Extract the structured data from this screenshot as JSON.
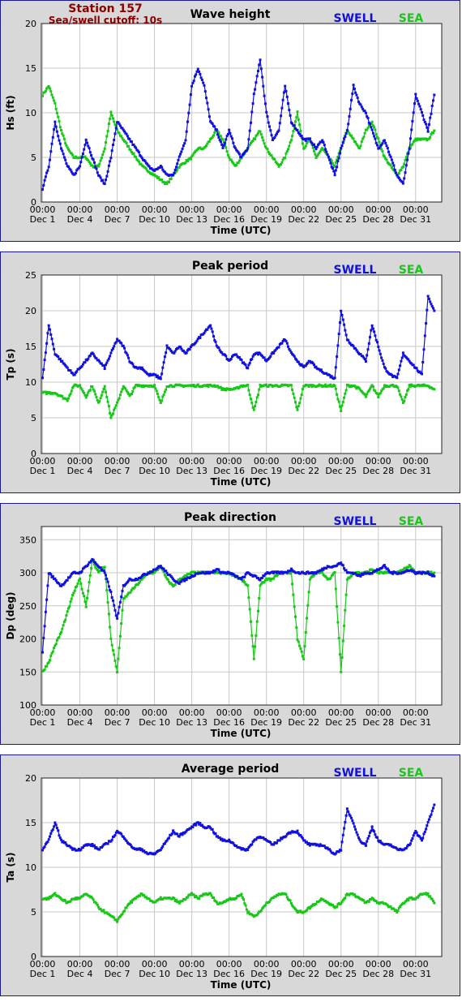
{
  "station": {
    "name": "Station 157",
    "cutoff": "Sea/swell cutoff: 10s"
  },
  "colors": {
    "swell": "#1010e0",
    "sea": "#18c818",
    "station_text": "#8b0000",
    "frame": "#1a1a99"
  },
  "legend": {
    "swell": "SWELL",
    "sea": "SEA"
  },
  "xaxis": {
    "title": "Time (UTC)",
    "time_labels": [
      "00:00",
      "00:00",
      "00:00",
      "00:00",
      "00:00",
      "00:00",
      "00:00",
      "00:00",
      "00:00",
      "00:00",
      "00:00"
    ],
    "date_labels": [
      "Dec 1",
      "Dec 4",
      "Dec 7",
      "Dec 10",
      "Dec 13",
      "Dec 16",
      "Dec 19",
      "Dec 22",
      "Dec 25",
      "Dec 28",
      "Dec 31"
    ],
    "tick_days": [
      1,
      4,
      7,
      10,
      13,
      16,
      19,
      22,
      25,
      28,
      31
    ],
    "range_days": [
      0.9,
      33.1
    ]
  },
  "chart_data": [
    {
      "type": "scatter",
      "title": "Wave height",
      "ylabel": "Hs (ft)",
      "ylim": [
        0,
        20
      ],
      "yticks": [
        0,
        5,
        10,
        15,
        20
      ],
      "grid": true,
      "legend_position": "top-right",
      "series": [
        {
          "name": "SWELL",
          "x": [
            1,
            1.5,
            2,
            2.5,
            3,
            3.5,
            4,
            4.5,
            5,
            5.5,
            6,
            6.5,
            7,
            7.5,
            8,
            8.5,
            9,
            9.5,
            10,
            10.5,
            11,
            11.5,
            12,
            12.5,
            13,
            13.5,
            14,
            14.5,
            15,
            15.5,
            16,
            16.5,
            17,
            17.5,
            18,
            18.5,
            19,
            19.5,
            20,
            20.5,
            21,
            21.5,
            22,
            22.5,
            23,
            23.5,
            24,
            24.5,
            25,
            25.5,
            26,
            26.5,
            27,
            27.5,
            28,
            28.5,
            29,
            29.5,
            30,
            30.5,
            31,
            31.5,
            32,
            32.5
          ],
          "y": [
            1.5,
            4,
            9,
            6,
            4,
            3,
            4,
            7,
            5,
            3,
            2,
            5,
            9,
            8,
            7,
            6,
            5,
            4,
            3.5,
            4,
            3,
            3,
            5,
            7,
            13,
            15,
            13,
            9,
            8,
            6,
            8,
            6,
            5,
            6,
            12,
            16,
            10,
            7,
            8,
            13,
            9,
            8,
            7,
            7,
            6,
            7,
            5,
            3,
            6,
            8,
            13,
            11,
            10,
            8,
            6,
            7,
            5,
            3,
            2,
            6,
            12,
            10,
            8,
            12
          ]
        },
        {
          "name": "SEA",
          "x": [
            1,
            1.5,
            2,
            2.5,
            3,
            3.5,
            4,
            4.5,
            5,
            5.5,
            6,
            6.5,
            7,
            7.5,
            8,
            8.5,
            9,
            9.5,
            10,
            10.5,
            11,
            11.5,
            12,
            12.5,
            13,
            13.5,
            14,
            14.5,
            15,
            15.5,
            16,
            16.5,
            17,
            17.5,
            18,
            18.5,
            19,
            19.5,
            20,
            20.5,
            21,
            21.5,
            22,
            22.5,
            23,
            23.5,
            24,
            24.5,
            25,
            25.5,
            26,
            26.5,
            27,
            27.5,
            28,
            28.5,
            29,
            29.5,
            30,
            30.5,
            31,
            31.5,
            32,
            32.5
          ],
          "y": [
            12,
            13,
            11,
            8,
            6,
            5,
            5,
            5,
            4,
            4,
            6,
            10,
            8,
            7,
            6,
            5,
            4,
            3.5,
            3,
            2.5,
            2,
            3,
            4,
            4.5,
            5,
            6,
            6,
            7,
            8,
            7,
            5,
            4,
            5,
            6,
            7,
            8,
            6,
            5,
            4,
            5,
            7,
            10,
            6,
            7,
            5,
            6,
            5,
            4,
            6,
            8,
            7,
            6,
            8,
            9,
            7,
            5,
            4,
            3,
            4,
            6,
            7,
            7,
            7,
            8
          ]
        }
      ]
    },
    {
      "type": "scatter",
      "title": "Peak period",
      "ylabel": "Tp (s)",
      "ylim": [
        0,
        25
      ],
      "yticks": [
        0,
        5,
        10,
        15,
        20,
        25
      ],
      "grid": true,
      "legend_position": "top-right",
      "series": [
        {
          "name": "SWELL",
          "x": [
            1,
            1.5,
            2,
            2.5,
            3,
            3.5,
            4,
            4.5,
            5,
            5.5,
            6,
            6.5,
            7,
            7.5,
            8,
            8.5,
            9,
            9.5,
            10,
            10.5,
            11,
            11.5,
            12,
            12.5,
            13,
            13.5,
            14,
            14.5,
            15,
            15.5,
            16,
            16.5,
            17,
            17.5,
            18,
            18.5,
            19,
            19.5,
            20,
            20.5,
            21,
            21.5,
            22,
            22.5,
            23,
            23.5,
            24,
            24.5,
            25,
            25.5,
            26,
            26.5,
            27,
            27.5,
            28,
            28.5,
            29,
            29.5,
            30,
            30.5,
            31,
            31.5,
            32,
            32.5
          ],
          "y": [
            10.5,
            18,
            14,
            13,
            12,
            11,
            12,
            13,
            14,
            13,
            12,
            14,
            16,
            15,
            13,
            12,
            12,
            11,
            11,
            10.5,
            15,
            14,
            15,
            14,
            15,
            16,
            17,
            18,
            15,
            14,
            13,
            14,
            13,
            12,
            14,
            14,
            13,
            14,
            15,
            16,
            14,
            13,
            12,
            13,
            12,
            11.5,
            11,
            10.5,
            20,
            16,
            15,
            14,
            13,
            18,
            15,
            12,
            11,
            10.5,
            14,
            13,
            12,
            11,
            22,
            20
          ]
        },
        {
          "name": "SEA",
          "x": [
            1,
            1.5,
            2,
            2.5,
            3,
            3.5,
            4,
            4.5,
            5,
            5.5,
            6,
            6.5,
            7,
            7.5,
            8,
            8.5,
            9,
            9.5,
            10,
            10.5,
            11,
            11.5,
            12,
            12.5,
            13,
            13.5,
            14,
            14.5,
            15,
            15.5,
            16,
            16.5,
            17,
            17.5,
            18,
            18.5,
            19,
            19.5,
            20,
            20.5,
            21,
            21.5,
            22,
            22.5,
            23,
            23.5,
            24,
            24.5,
            25,
            25.5,
            26,
            26.5,
            27,
            27.5,
            28,
            28.5,
            29,
            29.5,
            30,
            30.5,
            31,
            31.5,
            32,
            32.5
          ],
          "y": [
            8.5,
            8.5,
            8.5,
            8,
            7.5,
            9.5,
            9.5,
            8,
            9.5,
            7,
            9.5,
            5,
            7,
            9.5,
            8,
            9.5,
            9.5,
            9.5,
            9.5,
            7,
            9.5,
            9.5,
            9.5,
            9.5,
            9.5,
            9.5,
            9.5,
            9.5,
            9.5,
            9,
            9,
            9,
            9.5,
            9.5,
            6,
            9.5,
            9.5,
            9.5,
            9.5,
            9.5,
            9.5,
            6,
            9.5,
            9.5,
            9.5,
            9.5,
            9.5,
            9.5,
            6,
            9.5,
            9.5,
            9,
            8,
            9.5,
            8,
            9.5,
            9.5,
            9.5,
            7,
            9.5,
            9.5,
            9.5,
            9.5,
            9
          ]
        }
      ]
    },
    {
      "type": "scatter",
      "title": "Peak direction",
      "ylabel": "Dp (deg)",
      "ylim": [
        100,
        370
      ],
      "yticks": [
        100,
        150,
        200,
        250,
        300,
        350
      ],
      "grid": true,
      "legend_position": "top-right",
      "series": [
        {
          "name": "SWELL",
          "x": [
            1,
            1.5,
            2,
            2.5,
            3,
            3.5,
            4,
            4.5,
            5,
            5.5,
            6,
            6.5,
            7,
            7.5,
            8,
            8.5,
            9,
            9.5,
            10,
            10.5,
            11,
            11.5,
            12,
            12.5,
            13,
            13.5,
            14,
            14.5,
            15,
            15.5,
            16,
            16.5,
            17,
            17.5,
            18,
            18.5,
            19,
            19.5,
            20,
            20.5,
            21,
            21.5,
            22,
            22.5,
            23,
            23.5,
            24,
            24.5,
            25,
            25.5,
            26,
            26.5,
            27,
            27.5,
            28,
            28.5,
            29,
            29.5,
            30,
            30.5,
            31,
            31.5,
            32,
            32.5
          ],
          "y": [
            180,
            300,
            290,
            280,
            290,
            300,
            300,
            310,
            320,
            310,
            300,
            270,
            230,
            280,
            290,
            290,
            295,
            300,
            305,
            310,
            300,
            290,
            285,
            290,
            295,
            300,
            300,
            300,
            305,
            300,
            300,
            295,
            290,
            300,
            295,
            290,
            300,
            300,
            300,
            300,
            305,
            300,
            300,
            300,
            300,
            305,
            310,
            310,
            315,
            300,
            300,
            295,
            300,
            300,
            305,
            310,
            300,
            300,
            300,
            305,
            300,
            300,
            300,
            295
          ]
        },
        {
          "name": "SEA",
          "x": [
            1,
            1.5,
            2,
            2.5,
            3,
            3.5,
            4,
            4.5,
            5,
            5.5,
            6,
            6.5,
            7,
            7.5,
            8,
            8.5,
            9,
            9.5,
            10,
            10.5,
            11,
            11.5,
            12,
            12.5,
            13,
            13.5,
            14,
            14.5,
            15,
            15.5,
            16,
            16.5,
            17,
            17.5,
            18,
            18.5,
            19,
            19.5,
            20,
            20.5,
            21,
            21.5,
            22,
            22.5,
            23,
            23.5,
            24,
            24.5,
            25,
            25.5,
            26,
            26.5,
            27,
            27.5,
            28,
            28.5,
            29,
            29.5,
            30,
            30.5,
            31,
            31.5,
            32,
            32.5
          ],
          "y": [
            150,
            165,
            190,
            210,
            240,
            270,
            290,
            250,
            320,
            300,
            310,
            200,
            150,
            260,
            270,
            280,
            290,
            300,
            300,
            310,
            290,
            280,
            290,
            295,
            300,
            300,
            300,
            300,
            300,
            300,
            300,
            295,
            290,
            280,
            170,
            280,
            290,
            290,
            300,
            300,
            300,
            200,
            170,
            290,
            300,
            300,
            290,
            300,
            150,
            290,
            300,
            300,
            300,
            305,
            300,
            300,
            300,
            300,
            305,
            310,
            300,
            300,
            300,
            300
          ]
        }
      ]
    },
    {
      "type": "scatter",
      "title": "Average period",
      "ylabel": "Ta (s)",
      "ylim": [
        0,
        20
      ],
      "yticks": [
        0,
        5,
        10,
        15,
        20
      ],
      "grid": true,
      "legend_position": "top-right",
      "series": [
        {
          "name": "SWELL",
          "x": [
            1,
            1.5,
            2,
            2.5,
            3,
            3.5,
            4,
            4.5,
            5,
            5.5,
            6,
            6.5,
            7,
            7.5,
            8,
            8.5,
            9,
            9.5,
            10,
            10.5,
            11,
            11.5,
            12,
            12.5,
            13,
            13.5,
            14,
            14.5,
            15,
            15.5,
            16,
            16.5,
            17,
            17.5,
            18,
            18.5,
            19,
            19.5,
            20,
            20.5,
            21,
            21.5,
            22,
            22.5,
            23,
            23.5,
            24,
            24.5,
            25,
            25.5,
            26,
            26.5,
            27,
            27.5,
            28,
            28.5,
            29,
            29.5,
            30,
            30.5,
            31,
            31.5,
            32,
            32.5
          ],
          "y": [
            12,
            13,
            15,
            13,
            12.5,
            12,
            12,
            12.5,
            12.5,
            12,
            12.5,
            13,
            14,
            13.5,
            12.5,
            12,
            12,
            11.5,
            11.5,
            12,
            13,
            14,
            13.5,
            14,
            14.5,
            15,
            14.5,
            14.5,
            13.5,
            13,
            13,
            12.5,
            12,
            12,
            13,
            13.5,
            13,
            12.5,
            13,
            13.5,
            14,
            14,
            13,
            12.5,
            12.5,
            12.5,
            12,
            11.5,
            12,
            16.5,
            15,
            13,
            12.5,
            14.5,
            13,
            12.5,
            12.5,
            12,
            12,
            12.5,
            14,
            13,
            15,
            17
          ]
        },
        {
          "name": "SEA",
          "x": [
            1,
            1.5,
            2,
            2.5,
            3,
            3.5,
            4,
            4.5,
            5,
            5.5,
            6,
            6.5,
            7,
            7.5,
            8,
            8.5,
            9,
            9.5,
            10,
            10.5,
            11,
            11.5,
            12,
            12.5,
            13,
            13.5,
            14,
            14.5,
            15,
            15.5,
            16,
            16.5,
            17,
            17.5,
            18,
            18.5,
            19,
            19.5,
            20,
            20.5,
            21,
            21.5,
            22,
            22.5,
            23,
            23.5,
            24,
            24.5,
            25,
            25.5,
            26,
            26.5,
            27,
            27.5,
            28,
            28.5,
            29,
            29.5,
            30,
            30.5,
            31,
            31.5,
            32,
            32.5
          ],
          "y": [
            6.5,
            6.5,
            7,
            6.5,
            6,
            6.5,
            6.5,
            7,
            6.5,
            5.5,
            5,
            4.5,
            4,
            5,
            6,
            6.5,
            7,
            6.5,
            6,
            6.5,
            6.5,
            6.5,
            6,
            6.5,
            7,
            6.5,
            7,
            7,
            6,
            6,
            6.5,
            6.5,
            7,
            5,
            4.5,
            5,
            6,
            6.5,
            7,
            7,
            6,
            5,
            5,
            5.5,
            6,
            6.5,
            6,
            5.5,
            6,
            7,
            7,
            6.5,
            6,
            6.5,
            6,
            6,
            5.5,
            5,
            6,
            6.5,
            6.5,
            7,
            7,
            6
          ]
        }
      ]
    }
  ]
}
